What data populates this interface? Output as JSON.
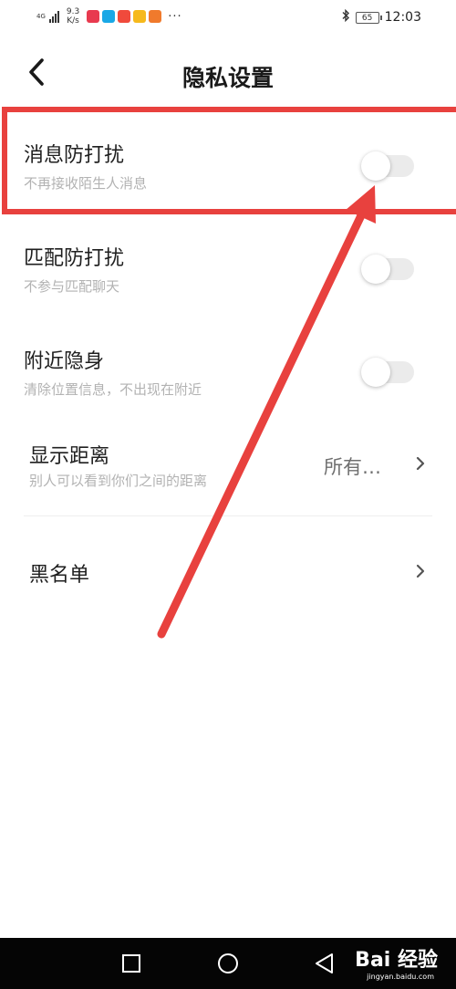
{
  "status_bar": {
    "network": "4G",
    "speed_value": "9.3",
    "speed_unit": "K/s",
    "battery": "65",
    "time": "12:03",
    "icons": [
      "bluetooth-icon",
      "battery-icon"
    ],
    "app_icon_colors": [
      "#e83a4f",
      "#19a8e6",
      "#f04a3c",
      "#f6b91c",
      "#f07a2c"
    ]
  },
  "header": {
    "title": "隐私设置",
    "back_icon": "chevron-left-icon"
  },
  "settings": {
    "msg_dnd": {
      "title": "消息防打扰",
      "subtitle": "不再接收陌生人消息",
      "enabled": false
    },
    "match_dnd": {
      "title": "匹配防打扰",
      "subtitle": "不参与匹配聊天",
      "enabled": false
    },
    "nearby_hide": {
      "title": "附近隐身",
      "subtitle": "清除位置信息，不出现在附近",
      "enabled": false
    },
    "show_distance": {
      "title": "显示距离",
      "subtitle": "别人可以看到你们之间的距离",
      "value": "所有…"
    },
    "blacklist": {
      "title": "黑名单"
    }
  },
  "annotation": {
    "color": "#e8413e"
  },
  "nav_bar": {
    "buttons": [
      "square-icon",
      "circle-icon",
      "triangle-back-icon"
    ],
    "watermark": "Bai 经验",
    "watermark_url": "jingyan.baidu.com"
  }
}
